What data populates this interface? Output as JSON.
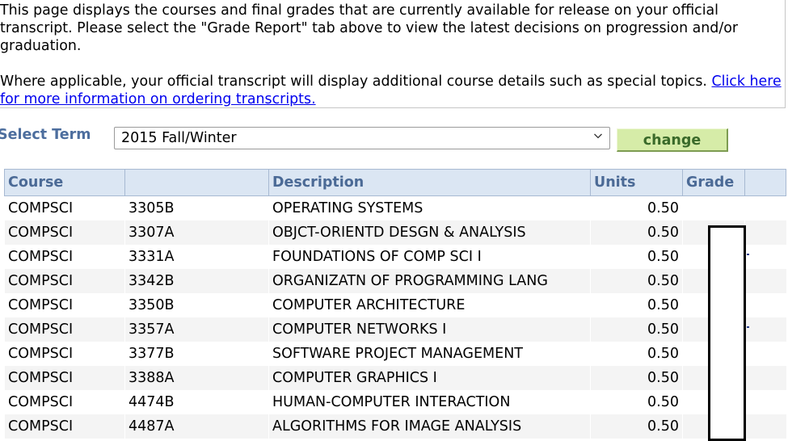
{
  "info": {
    "paragraph1": "This page displays the courses and final grades that are currently available for release on your official transcript. Please select the \"Grade Report\" tab above to view the latest decisions on progression and/or graduation.",
    "paragraph2": "Where applicable, your official transcript will display additional course details such as special topics. ",
    "link_text": "Click here for more information on ordering transcripts."
  },
  "term": {
    "label": "Select Term",
    "selected": "2015 Fall/Winter",
    "change_label": "change"
  },
  "table": {
    "headers": {
      "course": "Course",
      "number": "",
      "description": "Description",
      "units": "Units",
      "grade": "Grade",
      "extra": ""
    },
    "rows": [
      {
        "course": "COMPSCI",
        "number": "3305B",
        "description": "OPERATING SYSTEMS",
        "units": "0.50",
        "grade": ""
      },
      {
        "course": "COMPSCI",
        "number": "3307A",
        "description": "OBJCT-ORIENTD DESGN & ANALYSIS",
        "units": "0.50",
        "grade": ""
      },
      {
        "course": "COMPSCI",
        "number": "3331A",
        "description": "FOUNDATIONS OF COMP SCI I",
        "units": "0.50",
        "grade": ""
      },
      {
        "course": "COMPSCI",
        "number": "3342B",
        "description": "ORGANIZATN OF PROGRAMMING LANG",
        "units": "0.50",
        "grade": ""
      },
      {
        "course": "COMPSCI",
        "number": "3350B",
        "description": "COMPUTER ARCHITECTURE",
        "units": "0.50",
        "grade": ""
      },
      {
        "course": "COMPSCI",
        "number": "3357A",
        "description": "COMPUTER NETWORKS I",
        "units": "0.50",
        "grade": ""
      },
      {
        "course": "COMPSCI",
        "number": "3377B",
        "description": "SOFTWARE PROJECT MANAGEMENT",
        "units": "0.50",
        "grade": ""
      },
      {
        "course": "COMPSCI",
        "number": "3388A",
        "description": "COMPUTER GRAPHICS I",
        "units": "0.50",
        "grade": ""
      },
      {
        "course": "COMPSCI",
        "number": "4474B",
        "description": "HUMAN-COMPUTER INTERACTION",
        "units": "0.50",
        "grade": ""
      },
      {
        "course": "COMPSCI",
        "number": "4487A",
        "description": "ALGORITHMS FOR IMAGE ANALYSIS",
        "units": "0.50",
        "grade": ""
      }
    ]
  },
  "colors": {
    "header_bg": "#dbe6f3",
    "header_text": "#4b6a96",
    "label_text": "#4d6e9e",
    "button_bg": "#d6eca8",
    "button_text": "#3a6a2a",
    "link": "#0000ee"
  },
  "icons": {
    "select_arrow": "chevron-down-icon"
  }
}
